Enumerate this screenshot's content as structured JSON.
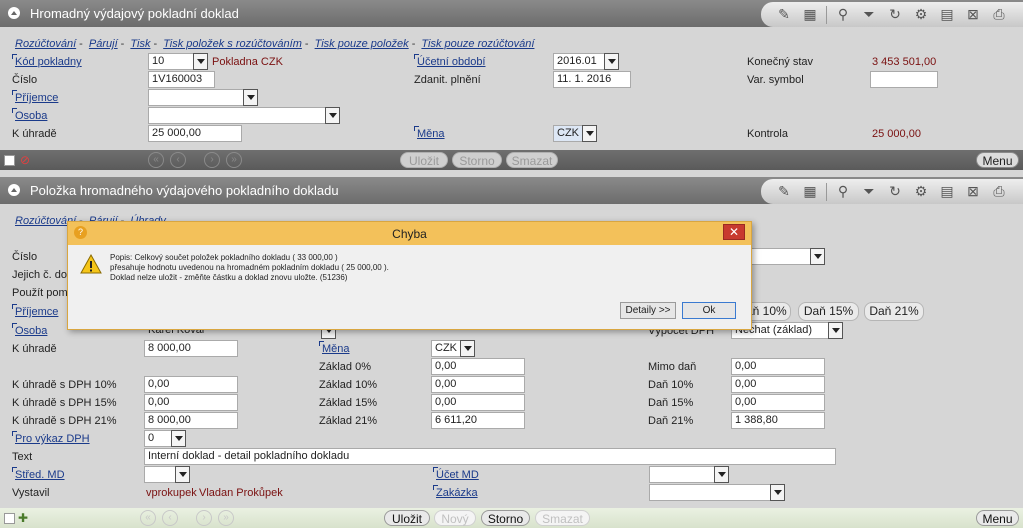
{
  "top": {
    "title": "Hromadný výdajový pokladní doklad",
    "links": [
      "Rozúčtování",
      "Párují",
      "Tisk",
      "Tisk položek s rozúčtováním",
      "Tisk pouze položek",
      "Tisk pouze rozúčtování"
    ],
    "kod_pokladny_label": "Kód pokladny",
    "kod_pokladny_value": "10",
    "kod_pokladny_name": "Pokladna CZK",
    "ucetni_obdobi_label": "Účetní období",
    "ucetni_obdobi_value": "2016.01",
    "konecny_stav_label": "Konečný stav",
    "konecny_stav_value": "3 453 501,00",
    "cislo_label": "Číslo",
    "cislo_value": "1V160003",
    "zdanit_label": "Zdanit. plnění",
    "zdanit_value": "11. 1. 2016",
    "var_symbol_label": "Var. symbol",
    "var_symbol_value": "",
    "prijemce_label": "Příjemce",
    "prijemce_value": "",
    "osoba_label": "Osoba",
    "osoba_value": "",
    "k_uhrade_label": "K úhradě",
    "k_uhrade_value": "25 000,00",
    "mena_label": "Měna",
    "mena_value": "CZK",
    "kontrola_label": "Kontrola",
    "kontrola_value": "25 000,00",
    "buttons": {
      "ulozit": "Uložit",
      "storno": "Storno",
      "smazat": "Smazat",
      "menu": "Menu"
    }
  },
  "item": {
    "title": "Položka hromadného výdajového pokladního dokladu",
    "links": [
      "Rozúčtování",
      "Párují",
      "Úhrady"
    ],
    "cislo_label": "Číslo",
    "jejich_label": "Jejich č. dokl",
    "pouzit_label": "Použít pomě",
    "prijemce_label": "Příjemce",
    "osoba_label": "Osoba",
    "osoba_value": "Karel Kovář",
    "dan_buttons": [
      "Daň 10%",
      "Daň 15%",
      "Daň 21%"
    ],
    "vypocet_label": "Výpočet DPH",
    "vypocet_value": "Nechat (základ)",
    "k_uhrade_label": "K úhradě",
    "k_uhrade_value": "8 000,00",
    "mena_label": "Měna",
    "mena_value": "CZK",
    "zaklad0_label": "Základ 0%",
    "zaklad0_value": "0,00",
    "mimo_dan_label": "Mimo daň",
    "mimo_dan_value": "0,00",
    "ku10_label": "K úhradě s DPH 10%",
    "ku10_value": "0,00",
    "zaklad10_label": "Základ 10%",
    "zaklad10_value": "0,00",
    "dan10_label": "Daň 10%",
    "dan10_value": "0,00",
    "ku15_label": "K úhradě s DPH 15%",
    "ku15_value": "0,00",
    "zaklad15_label": "Základ 15%",
    "zaklad15_value": "0,00",
    "dan15_label": "Daň 15%",
    "dan15_value": "0,00",
    "ku21_label": "K úhradě s DPH 21%",
    "ku21_value": "8 000,00",
    "zaklad21_label": "Základ 21%",
    "zaklad21_value": "6 611,20",
    "dan21_label": "Daň 21%",
    "dan21_value": "1 388,80",
    "vykaz_label": "Pro výkaz DPH",
    "vykaz_value": "0",
    "text_label": "Text",
    "text_value": "Interní doklad - detail pokladního dokladu",
    "stred_label": "Střed. MD",
    "ucet_label": "Účet MD",
    "vystavil_label": "Vystavil",
    "vystavil_user": "vprokupek",
    "vystavil_name": "Vladan Prokůpek",
    "zakazka_label": "Zakázka",
    "buttons": {
      "ulozit": "Uložit",
      "novy": "Nový",
      "storno": "Storno",
      "smazat": "Smazat",
      "menu": "Menu"
    }
  },
  "dialog": {
    "title": "Chyba",
    "close": "✕",
    "line1": "Popis: Celkový součet položek pokladního dokladu ( 33 000,00 )",
    "line2": "přesahuje hodnotu uvedenou na hromadném pokladním dokladu ( 25 000,00 ).",
    "line3": "Doklad nelze uložit - změňte částku a doklad znovu uložte. (51236)",
    "details": "Detaily >>",
    "ok": "Ok"
  }
}
